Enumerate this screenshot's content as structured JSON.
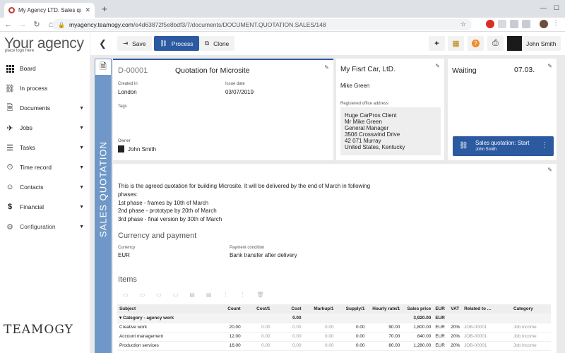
{
  "browser": {
    "tab_title": "My Agency LTD. Sales quotatio",
    "url_host": "myagency.teamogy.com",
    "url_path": "/e4d63872f5e8bdf3/7/documents/DOCUMENT.QUOTATION.SALES/148"
  },
  "sidebar": {
    "logo": "Your agency",
    "logo_sub": "place logo here",
    "brand": "TEAMOGY",
    "items": [
      {
        "label": "Board"
      },
      {
        "label": "In process"
      },
      {
        "label": "Documents"
      },
      {
        "label": "Jobs"
      },
      {
        "label": "Tasks"
      },
      {
        "label": "Time record"
      },
      {
        "label": "Contacts"
      },
      {
        "label": "Financial"
      },
      {
        "label": "Configuration"
      }
    ]
  },
  "toolbar": {
    "save_label": "Save",
    "process_label": "Process",
    "clone_label": "Clone",
    "user_name": "John Smith"
  },
  "document": {
    "type_label": "SALES QUOTATION",
    "number": "D-00001",
    "title": "Quotation for Microsite",
    "created_in_label": "Created in",
    "created_in": "London",
    "issue_date_label": "Issue date",
    "issue_date": "03/07/2019",
    "tags_label": "Tags",
    "owner_label": "Owner",
    "owner": "John Smith"
  },
  "client": {
    "name": "My Fisrt Car, LtD.",
    "contact": "Mike Green",
    "address_label": "Registered office address",
    "address_lines": [
      "Huge CarPros Client",
      "Mr  Mike Green",
      "General Manager",
      "3506  Crosswind Drive",
      "42 071 Murray",
      "United States, Kentucky"
    ]
  },
  "status": {
    "label": "Waiting",
    "date": "07.03.",
    "action_title": "Sales quotation: Start",
    "action_user": "John Smith"
  },
  "description": {
    "lines": [
      "This is the agreed quotation for building Microsite. It will be delivered by the end of March in following",
      "phases:",
      "1st phase - frames by 10th of March",
      "2nd phase - prototype by 20th of March",
      "3rd phase - final version by 30th of March"
    ]
  },
  "currency_payment": {
    "title": "Currency and payment",
    "currency_label": "Currency",
    "currency": "EUR",
    "payment_label": "Payment condition",
    "payment": "Bank transfer after delivery"
  },
  "items": {
    "title": "Items",
    "headers": [
      "Subject",
      "Count",
      "Cost/1",
      "Cost",
      "Markup/1",
      "Supply/1",
      "Hourly rate/1",
      "Sales price",
      "EUR",
      "VAT",
      "Related to ...",
      "Category"
    ],
    "category_row": {
      "label": "Category - agency work",
      "cost": "0.00",
      "sales_price": "3,920.00",
      "currency": "EUR"
    },
    "rows": [
      {
        "subject": "Creative work",
        "count": "20.00",
        "cost1": "0.00",
        "cost": "0.00",
        "markup": "0.00",
        "supply": "0.00",
        "rate": "90.00",
        "price": "1,800.00",
        "cur": "EUR",
        "vat": "20%",
        "related": "JOB-00001",
        "category": "Job income"
      },
      {
        "subject": "Account management",
        "count": "12.00",
        "cost1": "0.00",
        "cost": "0.00",
        "markup": "0.00",
        "supply": "0.00",
        "rate": "70.00",
        "price": "840.00",
        "cur": "EUR",
        "vat": "20%",
        "related": "JOB-00001",
        "category": "Job income"
      },
      {
        "subject": "Production services",
        "count": "16.00",
        "cost1": "0.00",
        "cost": "0.00",
        "markup": "0.00",
        "supply": "0.00",
        "rate": "80.00",
        "price": "1,280.00",
        "cur": "EUR",
        "vat": "20%",
        "related": "JOB-00001",
        "category": "Job income"
      }
    ]
  }
}
